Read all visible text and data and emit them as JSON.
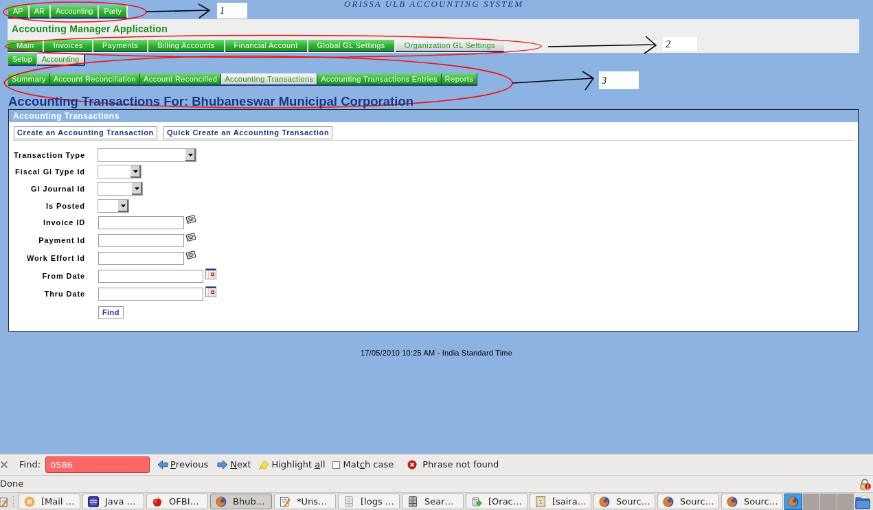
{
  "banner": {
    "title": "ORISSA ULB ACCOUNTING SYSTEM"
  },
  "app_tabs": [
    {
      "label": "AP",
      "selected": false
    },
    {
      "label": "AR",
      "selected": false
    },
    {
      "label": "Accounting",
      "selected": false
    },
    {
      "label": "Party",
      "selected": false
    }
  ],
  "app_header": {
    "title": "Accounting Manager Application",
    "tabs": [
      {
        "label": "Main",
        "selected": false
      },
      {
        "label": "Invoices",
        "selected": false
      },
      {
        "label": "Payments",
        "selected": false
      },
      {
        "label": "Billing Accounts",
        "selected": false
      },
      {
        "label": "Financial Account",
        "selected": false
      },
      {
        "label": "Global GL Settings",
        "selected": false
      },
      {
        "label": "Organization GL Settings",
        "selected": true
      }
    ]
  },
  "sub_tabs": [
    {
      "label": "Setup",
      "selected": false
    },
    {
      "label": "Accounting",
      "selected": true
    }
  ],
  "section_tabs": [
    {
      "label": "Summary",
      "selected": false
    },
    {
      "label": "Account Reconciliation",
      "selected": false
    },
    {
      "label": "Account Reconcilled",
      "selected": false
    },
    {
      "label": "Accounting Transactions",
      "selected": true
    },
    {
      "label": "Accounting Transactions Entries",
      "selected": false
    },
    {
      "label": "Reports",
      "selected": false
    }
  ],
  "page_title": "Accounting Transactions For: Bhubaneswar Municipal Corporation",
  "panel": {
    "title": "Accounting Transactions",
    "actions": [
      "Create an Accounting Transaction",
      "Quick Create an Accounting Transaction"
    ],
    "fields": [
      {
        "label": "Transaction Type",
        "kind": "select"
      },
      {
        "label": "Fiscal Gl Type Id",
        "kind": "select"
      },
      {
        "label": "Gl Journal Id",
        "kind": "select"
      },
      {
        "label": "Is Posted",
        "kind": "select"
      },
      {
        "label": "Invoice ID",
        "kind": "lookup"
      },
      {
        "label": "Payment Id",
        "kind": "lookup"
      },
      {
        "label": "Work Effort Id",
        "kind": "lookup"
      },
      {
        "label": "From Date",
        "kind": "date"
      },
      {
        "label": "Thru Date",
        "kind": "date"
      }
    ],
    "submit": "Find"
  },
  "footer": {
    "timestamp": "17/05/2010 10:25 AM - India Standard Time"
  },
  "annotations": [
    {
      "label": "1"
    },
    {
      "label": "2"
    },
    {
      "label": "3"
    }
  ],
  "find_bar": {
    "label": "Find:",
    "query": "0586",
    "not_found": true,
    "actions": [
      {
        "kind": "previous",
        "mnemonic": "P",
        "after": "revious"
      },
      {
        "kind": "next",
        "mnemonic": "N",
        "after": "ext"
      },
      {
        "kind": "highlight",
        "before": "Highlight ",
        "mnemonic": "a",
        "after": "ll"
      }
    ],
    "match_case": {
      "before": "Mat",
      "mnemonic": "c",
      "after": "h case",
      "checked": false
    },
    "message": "Phrase not found"
  },
  "status_bar": {
    "text": "Done"
  },
  "taskbar": {
    "items": [
      {
        "label": "[Mail …",
        "kind": "mail",
        "selected": false
      },
      {
        "label": "Java …",
        "kind": "ide",
        "selected": false
      },
      {
        "label": "OFBI…",
        "kind": "apple",
        "selected": false
      },
      {
        "label": "Bhub…",
        "kind": "browser",
        "selected": true
      },
      {
        "label": "*Uns…",
        "kind": "editor",
        "selected": false
      },
      {
        "label": "[logs …",
        "kind": "files",
        "selected": false
      },
      {
        "label": "Sear…",
        "kind": "cabinet",
        "selected": false
      },
      {
        "label": "[Orac…",
        "kind": "database",
        "selected": false
      },
      {
        "label": "[saira…",
        "kind": "image",
        "selected": false
      },
      {
        "label": "Sourc…",
        "kind": "browser",
        "selected": false
      },
      {
        "label": "Sourc…",
        "kind": "browser",
        "selected": false
      },
      {
        "label": "Sourc…",
        "kind": "browser",
        "selected": false
      }
    ],
    "workspaces": [
      {
        "selected": true
      },
      {
        "selected": false
      },
      {
        "selected": false
      },
      {
        "selected": false
      }
    ]
  }
}
